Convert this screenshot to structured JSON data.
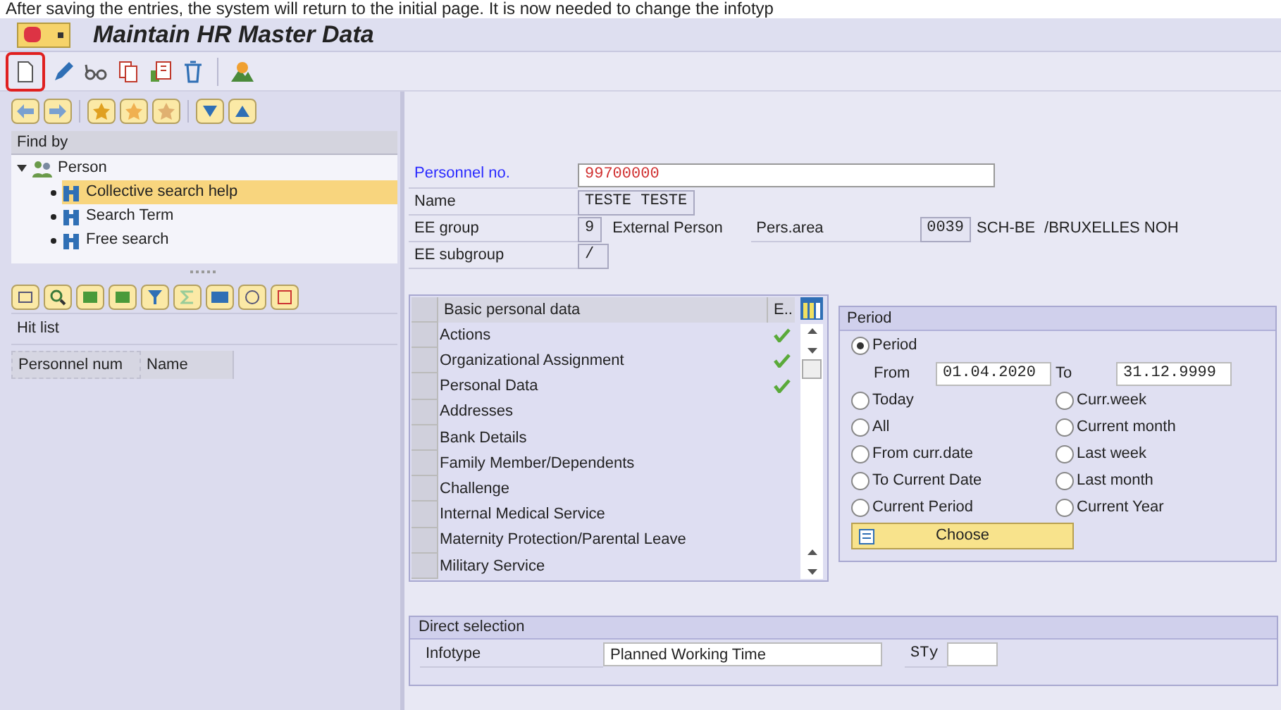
{
  "caption": "After saving the entries, the system will return to the initial page. It is now needed to change the infotyp",
  "window": {
    "title": "Maintain HR Master Data"
  },
  "toolbar": [
    {
      "kind": "create",
      "highlighted": true
    },
    {
      "kind": "change",
      "highlighted": false
    },
    {
      "kind": "display",
      "highlighted": false
    },
    {
      "kind": "copy",
      "highlighted": false
    },
    {
      "kind": "overview",
      "highlighted": false
    },
    {
      "kind": "delete",
      "highlighted": false
    },
    {
      "kind": "person",
      "highlighted": false
    }
  ],
  "find_by": {
    "title": "Find by",
    "tree": [
      {
        "label": "Person",
        "expanded": true,
        "children": [
          {
            "label": "Collective search help",
            "selected": true
          },
          {
            "label": "Search Term",
            "selected": false
          },
          {
            "label": "Free search",
            "selected": false
          }
        ]
      }
    ]
  },
  "hit_list": {
    "title": "Hit list",
    "columns": [
      "Personnel num",
      "Name"
    ]
  },
  "header": {
    "personnel_no": {
      "label": "Personnel no.",
      "value": "99700000"
    },
    "name": {
      "label": "Name",
      "value": "TESTE TESTE"
    },
    "ee_group": {
      "label": "EE group",
      "code": "9",
      "text": "External Person"
    },
    "pers_area": {
      "label": "Pers.area",
      "code": "0039",
      "text": "SCH-BE",
      "text2": "/BRUXELLES NOH"
    },
    "ee_subgroup": {
      "label": "EE subgroup",
      "value": "/"
    }
  },
  "infotypes": {
    "columns": [
      "Basic personal data",
      "E.."
    ],
    "rows": [
      {
        "name": "Actions",
        "exists": true
      },
      {
        "name": "Organizational Assignment",
        "exists": true
      },
      {
        "name": "Personal Data",
        "exists": true
      },
      {
        "name": "Addresses",
        "exists": false
      },
      {
        "name": "Bank Details",
        "exists": false
      },
      {
        "name": "Family Member/Dependents",
        "exists": false
      },
      {
        "name": "Challenge",
        "exists": false
      },
      {
        "name": "Internal Medical Service",
        "exists": false
      },
      {
        "name": "Maternity Protection/Parental Leave",
        "exists": false
      },
      {
        "name": "Military Service",
        "exists": false
      }
    ]
  },
  "period": {
    "title": "Period",
    "main_option": {
      "label": "Period",
      "selected": true
    },
    "from_label": "From",
    "from": "01.04.2020",
    "to_label": "To",
    "to": "31.12.9999",
    "left_options": [
      {
        "label": "Today",
        "selected": false
      },
      {
        "label": "All",
        "selected": false
      },
      {
        "label": "From curr.date",
        "selected": false
      },
      {
        "label": "To Current Date",
        "selected": false
      },
      {
        "label": "Current Period",
        "selected": false
      }
    ],
    "right_options": [
      {
        "label": "Curr.week",
        "selected": false
      },
      {
        "label": "Current month",
        "selected": false
      },
      {
        "label": "Last week",
        "selected": false
      },
      {
        "label": "Last month",
        "selected": false
      },
      {
        "label": "Current Year",
        "selected": false
      }
    ],
    "choose": "Choose"
  },
  "direct_selection": {
    "title": "Direct selection",
    "infotype_label": "Infotype",
    "infotype_value": "Planned Working Time",
    "subtype_label": "STy"
  }
}
